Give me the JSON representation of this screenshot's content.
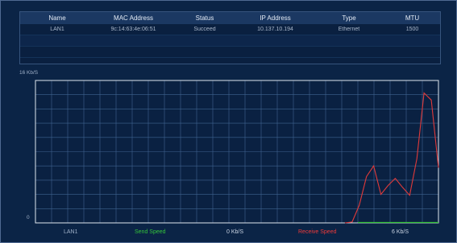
{
  "table": {
    "headers": [
      "Name",
      "MAC Address",
      "Status",
      "IP Address",
      "Type",
      "MTU"
    ],
    "rows": [
      [
        "LAN1",
        "9c:14:63:4e:06:51",
        "Succeed",
        "10.137.10.194",
        "Ethernet",
        "1500"
      ]
    ]
  },
  "chart": {
    "y_max_label": "16 Kb/S",
    "y_min_label": "0"
  },
  "chart_data": {
    "type": "line",
    "ylim": [
      0,
      16
    ],
    "y_unit": "Kb/S",
    "grid": true,
    "series": [
      {
        "name": "Receive Speed",
        "color": "#e03a3a",
        "values": [
          0,
          0,
          0,
          0,
          0,
          0,
          0,
          0,
          0,
          0,
          0,
          0,
          0,
          0,
          0,
          0,
          0,
          0,
          0,
          0,
          0,
          0,
          0,
          0,
          0,
          0,
          0,
          0,
          0,
          0,
          0,
          0,
          0,
          0,
          0,
          0,
          0,
          0,
          0,
          0,
          0,
          0,
          0,
          0,
          0.1,
          2.0,
          5.2,
          6.4,
          3.2,
          4.2,
          5.0,
          4.0,
          3.1,
          7.2,
          14.6,
          13.8,
          6.2
        ]
      },
      {
        "name": "Send Speed",
        "color": "#34c43a",
        "values": [
          0,
          0,
          0,
          0,
          0,
          0,
          0,
          0,
          0,
          0,
          0,
          0,
          0,
          0,
          0,
          0,
          0,
          0,
          0,
          0,
          0,
          0,
          0,
          0,
          0,
          0,
          0,
          0,
          0,
          0,
          0,
          0,
          0,
          0,
          0,
          0,
          0,
          0,
          0,
          0,
          0,
          0,
          0,
          0,
          0,
          0,
          0,
          0,
          0,
          0,
          0,
          0,
          0,
          0,
          0,
          0,
          0
        ]
      }
    ]
  },
  "legend": {
    "interface": "LAN1",
    "send_label": "Send Speed",
    "send_value": "0 Kb/S",
    "receive_label": "Receive Speed",
    "receive_value": "6 Kb/S"
  },
  "colors": {
    "background": "#0b2446",
    "grid": "#3f6390",
    "send": "#34c43a",
    "receive": "#e03a3a"
  }
}
